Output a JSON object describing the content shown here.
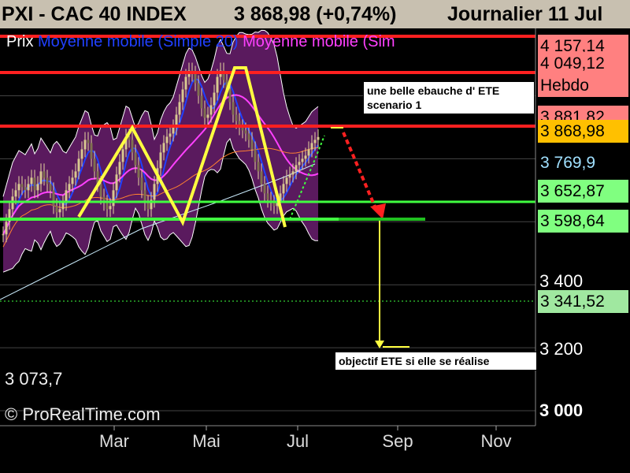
{
  "header": {
    "instrument": "PXI - CAC 40 INDEX",
    "price_change": "3 868,98 (+0,74%)",
    "period": "Journalier  11 Jul"
  },
  "legend": {
    "prix": "Prix",
    "ma20": "Moyenne mobile (Simple 20)",
    "ma_other": "Moyenne mobile (Sim"
  },
  "annotations": {
    "ete_line1": "une belle ebauche  d' ETE",
    "ete_line2": "scenario  1",
    "objective": "objectif ETE si elle se réalise"
  },
  "price_tags": [
    {
      "text": "4 157,14",
      "bg": "#ff8080",
      "color": "#000"
    },
    {
      "text": "4 049,12",
      "bg": "#ff8080",
      "color": "#000"
    },
    {
      "text": "Hebdo",
      "bg": "#ff8080",
      "color": "#000"
    },
    {
      "text": "3 881,82",
      "bg": "#ff8080",
      "color": "#000"
    },
    {
      "text": "3 868,98",
      "bg": "#ffc000",
      "color": "#000"
    },
    {
      "text": "3 769,9",
      "bg": "#000000",
      "color": "#a0e0ff"
    },
    {
      "text": "3 652,87",
      "bg": "#80ff80",
      "color": "#000"
    },
    {
      "text": "3 598,64",
      "bg": "#80ff80",
      "color": "#000"
    },
    {
      "text": "3 341,52",
      "bg": "#a0e8a0",
      "color": "#000"
    }
  ],
  "y_axis_labels": [
    "3 400",
    "3 200",
    "3 000"
  ],
  "footer": {
    "min_label": "3 073,7",
    "watermark": "© ProRealTime.com"
  },
  "colors": {
    "resistance": "#ff2020",
    "support": "#40ff40",
    "pattern": "#ffff40",
    "bollinger_fill": "#5a1a5e",
    "ma20": "#2040ff",
    "ma_other": "#ff40ff"
  },
  "chart_data": {
    "type": "line",
    "x_ticks": [
      "Mar",
      "Mai",
      "Jul",
      "Sep",
      "Nov"
    ],
    "ylim": [
      2950,
      4190
    ],
    "y_ticks": [
      3000,
      3200,
      3400
    ],
    "horizontal_levels": {
      "resistance": [
        4157.14,
        4049.12,
        3881.82
      ],
      "support": [
        3652.87,
        3598.64
      ],
      "target": 3341.52
    },
    "series": [
      {
        "x": [
          0,
          4,
          8,
          12,
          16,
          20,
          24,
          28,
          32,
          36,
          40,
          44,
          48,
          52,
          56,
          60,
          64,
          68,
          72,
          76,
          80,
          84,
          88,
          92,
          96,
          100,
          104,
          108,
          112,
          116,
          120,
          124,
          128,
          132,
          136,
          140,
          144,
          148,
          152,
          156,
          160,
          164,
          168,
          172,
          176,
          180,
          184,
          188,
          192,
          196,
          200,
          204,
          208,
          212,
          216,
          220,
          224,
          228,
          232,
          236,
          240,
          244,
          248,
          252,
          256,
          260,
          264,
          268,
          272,
          276,
          280,
          284,
          288,
          292,
          296,
          300,
          304,
          308,
          312,
          316,
          320,
          324,
          328,
          332,
          336,
          340,
          344,
          348,
          352,
          356,
          360,
          364,
          368,
          372,
          376,
          380,
          384,
          388,
          392,
          396,
          400
        ],
        "values": [
          3560,
          3600,
          3640,
          3680,
          3700,
          3720,
          3710,
          3700,
          3720,
          3740,
          3700,
          3720,
          3760,
          3740,
          3720,
          3700,
          3650,
          3630,
          3640,
          3660,
          3700,
          3720,
          3740,
          3760,
          3800,
          3830,
          3860,
          3850,
          3800,
          3760,
          3720,
          3680,
          3660,
          3640,
          3650,
          3700,
          3750,
          3790,
          3830,
          3870,
          3860,
          3820,
          3780,
          3740,
          3700,
          3660,
          3640,
          3670,
          3720,
          3770,
          3820,
          3850,
          3870,
          3880,
          3900,
          3940,
          3980,
          4020,
          4060,
          4080,
          4070,
          4040,
          4000,
          3960,
          3930,
          3940,
          3970,
          4010,
          4060,
          4080,
          4050,
          4020,
          3980,
          3940,
          3920,
          3900,
          3890,
          3880,
          3860,
          3830,
          3790,
          3760,
          3720,
          3690,
          3670,
          3660,
          3650,
          3660,
          3690,
          3720,
          3740,
          3750,
          3760,
          3780,
          3790,
          3800,
          3810,
          3830,
          3850,
          3860,
          3869
        ]
      }
    ]
  }
}
